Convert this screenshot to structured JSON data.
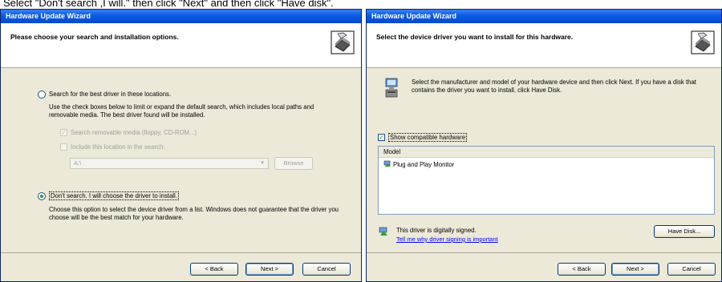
{
  "caption": "Select \"Don't search ,I will.\" then click \"Next\" and then click \"Have disk\".",
  "left_window": {
    "title": "Hardware Update Wizard",
    "header_title": "Please choose your search and installation options.",
    "header_icon": "hardware-wizard-icon",
    "option_search": {
      "label": "Search for the best driver in these locations.",
      "selected": false
    },
    "search_description": "Use the check boxes below to limit or expand the default search, which includes local paths and removable media. The best driver found will be installed.",
    "check_removable": {
      "label": "Search removable media (floppy, CD-ROM...)",
      "checked": true,
      "enabled": false
    },
    "check_location": {
      "label": "Include this location in the search:",
      "checked": false,
      "enabled": false
    },
    "location_value": "A:\\",
    "browse_label": "Browse",
    "option_dont_search": {
      "label": "Don't search. I will choose the driver to install.",
      "selected": true
    },
    "dont_search_description": "Choose this option to select the device driver from a list. Windows does not guarantee that the driver you choose will be the best match for your hardware.",
    "buttons": {
      "back": "< Back",
      "next": "Next >",
      "cancel": "Cancel"
    }
  },
  "right_window": {
    "title": "Hardware Update Wizard",
    "header_title": "Select the device driver you want to install for this hardware.",
    "header_icon": "hardware-wizard-icon",
    "info_icon": "monitor-device-icon",
    "info_text": "Select the manufacturer and model of your hardware device and then click Next. If you have a disk that contains the driver you want to install, click Have Disk.",
    "show_compatible": {
      "label": "Show compatible hardware",
      "checked": true
    },
    "list_header": "Model",
    "models": [
      "Plug and Play Monitor"
    ],
    "signed_icon": "signed-driver-icon",
    "signed_text": "This driver is digitally signed.",
    "signing_link": "Tell me why driver signing is important",
    "have_disk": "Have Disk...",
    "buttons": {
      "back": "< Back",
      "next": "Next >",
      "cancel": "Cancel"
    }
  },
  "colors": {
    "titlebar": "#0a5ae0",
    "dialog_bg": "#ece9d8",
    "link": "#0000ff",
    "check_green": "#21a121"
  }
}
